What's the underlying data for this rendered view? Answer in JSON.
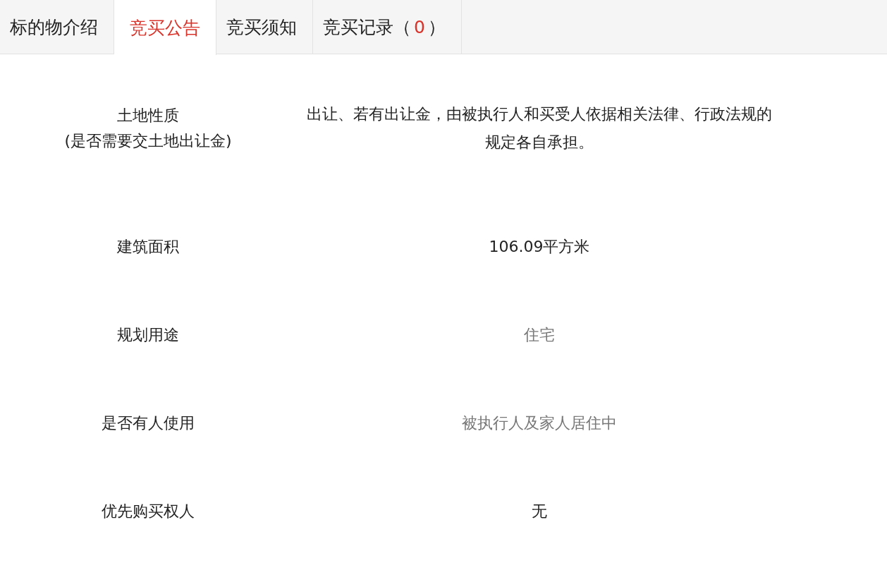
{
  "tabs": [
    {
      "label": "标的物介绍",
      "selected": false
    },
    {
      "label": "竞买公告",
      "selected": true
    },
    {
      "label": "竞买须知",
      "selected": false
    },
    {
      "label": "竞买记录（",
      "count": "0",
      "suffix": "）",
      "selected": false
    }
  ],
  "rows": [
    {
      "label": "土地性质",
      "note": "(是否需要交土地出让金)",
      "value": "出让、若有出让金，由被执行人和买受人依据相关法律、行政法规的规定各自承担。",
      "dimmed": false
    },
    {
      "label": "建筑面积",
      "value": "106.09平方米",
      "dimmed": false
    },
    {
      "label": "规划用途",
      "value": "住宅",
      "dimmed": true
    },
    {
      "label": "是否有人使用",
      "value": "被执行人及家人居住中",
      "dimmed": true
    },
    {
      "label": "优先购买权人",
      "value": "无",
      "dimmed": false
    }
  ]
}
